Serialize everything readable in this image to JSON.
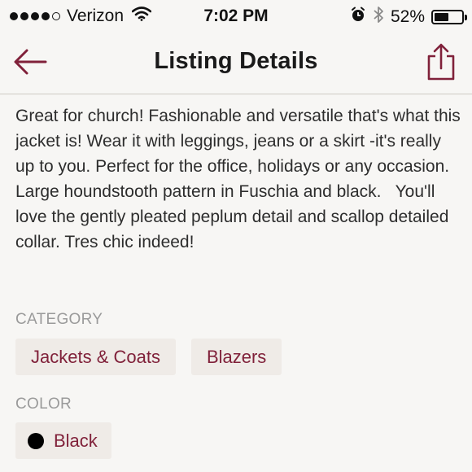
{
  "status_bar": {
    "carrier": "Verizon",
    "time": "7:02 PM",
    "battery_percent": "52%",
    "battery_level": 0.52,
    "signal_bars_filled": 4,
    "signal_bars_total": 5
  },
  "nav": {
    "title": "Listing Details",
    "back_icon": "back-arrow-icon",
    "share_icon": "share-icon"
  },
  "listing": {
    "description": "Great for church! Fashionable and versatile that's what this jacket is! Wear it with leggings, jeans or a skirt -it's really up to you. Perfect for the office, holidays or any occasion. Large houndstooth pattern in Fuschia and black.   You'll love the gently pleated peplum detail and scallop detailed collar. Tres chic indeed!",
    "category": {
      "label": "CATEGORY",
      "tags": [
        "Jackets & Coats",
        "Blazers"
      ]
    },
    "color": {
      "label": "COLOR",
      "value": "Black",
      "swatch": "#000000"
    }
  },
  "colors": {
    "accent": "#80213a",
    "tag_background": "#efebe7",
    "background": "#f7f6f4"
  }
}
